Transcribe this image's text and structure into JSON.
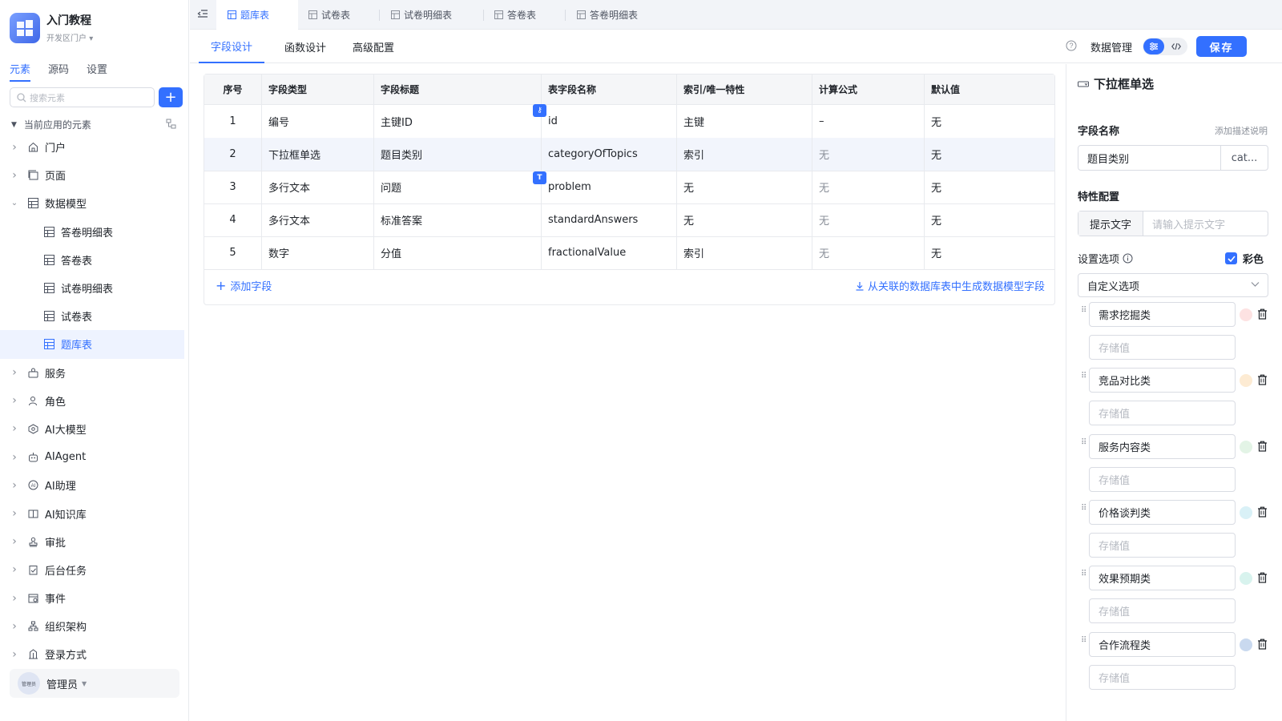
{
  "app": {
    "name": "入门教程",
    "portal": "开发区门户"
  },
  "sidebar": {
    "tabs": [
      {
        "label": "元素"
      },
      {
        "label": "源码"
      },
      {
        "label": "设置"
      }
    ],
    "search_placeholder": "搜索元素",
    "add_label": "+",
    "section_title": "当前应用的元素",
    "items": [
      {
        "label": "门户",
        "icon": "home-icon",
        "expandable": true
      },
      {
        "label": "页面",
        "icon": "page-icon",
        "expandable": true
      },
      {
        "label": "数据模型",
        "icon": "table-icon",
        "expandable": true,
        "expanded": true
      },
      {
        "label": "答卷明细表",
        "icon": "table-icon",
        "child": true
      },
      {
        "label": "答卷表",
        "icon": "table-icon",
        "child": true
      },
      {
        "label": "试卷明细表",
        "icon": "table-icon",
        "child": true
      },
      {
        "label": "试卷表",
        "icon": "table-icon",
        "child": true
      },
      {
        "label": "题库表",
        "icon": "table-icon",
        "child": true,
        "selected": true
      },
      {
        "label": "服务",
        "icon": "service-icon",
        "expandable": true
      },
      {
        "label": "角色",
        "icon": "role-icon",
        "expandable": true
      },
      {
        "label": "AI大模型",
        "icon": "ai-model-icon",
        "expandable": true
      },
      {
        "label": "AIAgent",
        "icon": "robot-icon",
        "expandable": true
      },
      {
        "label": "AI助理",
        "icon": "ai-assistant-icon",
        "expandable": true
      },
      {
        "label": "AI知识库",
        "icon": "book-icon",
        "expandable": true
      },
      {
        "label": "审批",
        "icon": "stamp-icon",
        "expandable": true
      },
      {
        "label": "后台任务",
        "icon": "task-icon",
        "expandable": true
      },
      {
        "label": "事件",
        "icon": "event-icon",
        "expandable": true
      },
      {
        "label": "组织架构",
        "icon": "org-icon",
        "expandable": true
      },
      {
        "label": "登录方式",
        "icon": "login-icon",
        "expandable": true
      }
    ],
    "user": {
      "name": "管理员",
      "avatar_text": "管理员"
    }
  },
  "top_tabs": [
    {
      "label": "题库表",
      "active": true
    },
    {
      "label": "试卷表"
    },
    {
      "label": "试卷明细表"
    },
    {
      "label": "答卷表"
    },
    {
      "label": "答卷明细表"
    }
  ],
  "sub_tabs": [
    {
      "label": "字段设计"
    },
    {
      "label": "函数设计"
    },
    {
      "label": "高级配置"
    }
  ],
  "toolbar": {
    "data_manage": "数据管理",
    "save": "保存"
  },
  "table": {
    "headers": [
      "序号",
      "字段类型",
      "字段标题",
      "表字段名称",
      "索引/唯一特性",
      "计算公式",
      "默认值"
    ],
    "rows": [
      [
        "1",
        "编号",
        "主键ID",
        "id",
        "主键",
        "–",
        "无"
      ],
      [
        "2",
        "下拉框单选",
        "题目类别",
        "categoryOfTopics",
        "索引",
        "无",
        "无"
      ],
      [
        "3",
        "多行文本",
        "问题",
        "problem",
        "无",
        "无",
        "无"
      ],
      [
        "4",
        "多行文本",
        "标准答案",
        "standardAnswers",
        "无",
        "无",
        "无"
      ],
      [
        "5",
        "数字",
        "分值",
        "fractionalValue",
        "索引",
        "无",
        "无"
      ]
    ],
    "add_field": "添加字段",
    "generate_link": "从关联的数据库表中生成数据模型字段"
  },
  "panel": {
    "title": "下拉框单选",
    "field_name_label": "字段名称",
    "add_desc": "添加描述说明",
    "field_title_value": "题目类别",
    "field_key_value": "cat...",
    "feature_label": "特性配置",
    "hint_label": "提示文字",
    "hint_placeholder": "请输入提示文字",
    "options_label": "设置选项",
    "color_label": "彩色",
    "custom_option": "自定义选项",
    "store_placeholder": "存储值",
    "options": [
      {
        "label": "需求挖掘类",
        "color": "#fde2e2"
      },
      {
        "label": "竞品对比类",
        "color": "#fdebd3"
      },
      {
        "label": "服务内容类",
        "color": "#e3f4e6"
      },
      {
        "label": "价格谈判类",
        "color": "#d9f1f7"
      },
      {
        "label": "效果预期类",
        "color": "#d8f3ee"
      },
      {
        "label": "合作流程类",
        "color": "#c9d9ef"
      }
    ]
  },
  "colors": {
    "accent": "#3370ff",
    "border": "#e8eaee"
  }
}
